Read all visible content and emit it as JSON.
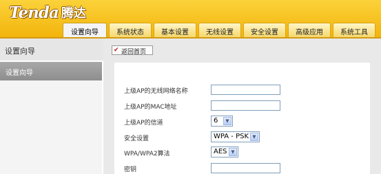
{
  "logo": {
    "brand": "Tenda",
    "brand_cn": "腾达"
  },
  "tabs": [
    {
      "label": "设置向导",
      "active": true
    },
    {
      "label": "系统状态",
      "active": false
    },
    {
      "label": "基本设置",
      "active": false
    },
    {
      "label": "无线设置",
      "active": false
    },
    {
      "label": "安全设置",
      "active": false
    },
    {
      "label": "高级应用",
      "active": false
    },
    {
      "label": "系统工具",
      "active": false
    }
  ],
  "sidebar": {
    "title": "设置向导",
    "items": [
      {
        "label": "设置向导",
        "selected": true
      }
    ]
  },
  "toolbar": {
    "back_label": "返回首页",
    "back_icon": "back-arrow-icon"
  },
  "form": {
    "upstream_ssid_label": "上级AP的无线网络名称",
    "upstream_ssid_value": "",
    "upstream_mac_label": "上级AP的MAC地址",
    "upstream_mac_value": "",
    "upstream_channel_label": "上级AP的信道",
    "upstream_channel_value": "6",
    "security_label": "安全设置",
    "security_value": "WPA - PSK",
    "algorithm_label": "WPA/WPA2算法",
    "algorithm_value": "AES",
    "key_label": "密钥",
    "key_value": ""
  },
  "colors": {
    "header_yellow": "#f6c21f",
    "header_rule": "#d39a12",
    "sidebar_selected": "#999999",
    "panel_grey": "#e9e9e9"
  }
}
